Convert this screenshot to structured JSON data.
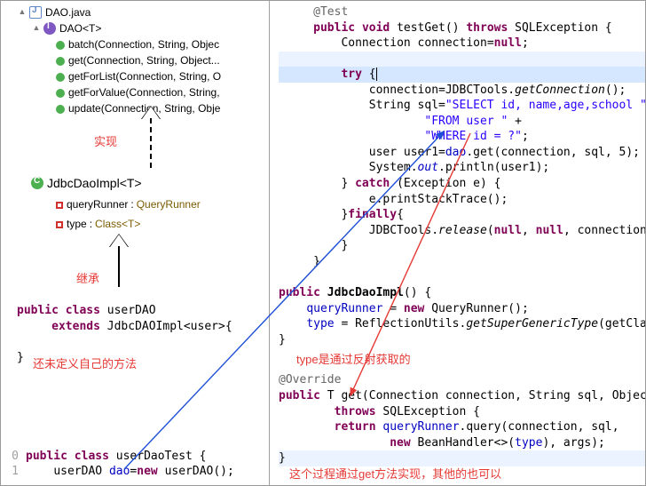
{
  "left": {
    "file": "DAO.java",
    "iface": "DAO<T>",
    "methods": [
      "batch(Connection, String, Objec",
      "get(Connection, String, Object...",
      "getForList(Connection, String, O",
      "getForValue(Connection, String,",
      "update(Connection, String, Obje"
    ],
    "anno_impl": "实现",
    "class_impl": "JdbcDaoImpl<T>",
    "fields": [
      {
        "name": "queryRunner",
        "type": "QueryRunner"
      },
      {
        "name": "type",
        "type": "Class<T>"
      }
    ],
    "anno_inherit": "继承",
    "userdao_code": {
      "l1a": "public",
      "l1b": "class",
      "l1c": "userDAO",
      "l2a": "extends",
      "l2b": "JdbcDAOImpl<user>{",
      "l3": "}"
    },
    "anno_undef": "还未定义自己的方法",
    "test_code": {
      "n0": "0",
      "n1": "1",
      "l1a": "public",
      "l1b": "class",
      "l1c": "userDaoTest {",
      "l2a": "userDAO",
      "l2b": "dao",
      "l2c": "=",
      "l2d": "new",
      "l2e": "userDAO();"
    }
  },
  "right": {
    "code": {
      "a1": "@Test",
      "a2_pub": "public",
      "a2_void": "void",
      "a2_name": "testGet()",
      "a2_throws": "throws",
      "a2_ex": "SQLException {",
      "a3": "Connection connection=",
      "a3_null": "null",
      "a3_semi": ";",
      "a4_try": "try",
      "a4_br": "{",
      "a5a": "connection=JDBCTools.",
      "a5b": "getConnection",
      "a5c": "();",
      "a6a": "String sql=",
      "a6b": "\"SELECT id, name,age,school \"",
      "a6c": " +",
      "a7a": "\"FROM user \"",
      "a7b": " +",
      "a8a": "\"WHERE id = ?\"",
      "a8b": ";",
      "a9a": "user user1=",
      "a9b": "dao",
      "a9c": ".get(connection, sql, 5);",
      "a10a": "System.",
      "a10b": "out",
      "a10c": ".println(user1);",
      "a11a": "}",
      "a11b": "catch",
      "a11c": " (Exception e) {",
      "a12": "e.printStackTrace();",
      "a13a": "}",
      "a13b": "finally",
      "a13c": "{",
      "a14a": "JDBCTools.",
      "a14b": "release",
      "a14c": "(",
      "a14d": "null",
      "a14e": ", ",
      "a14f": "null",
      "a14g": ", connection);",
      "a15": "}",
      "a16": "}",
      "b1_pub": "public",
      "b1_name": "JdbcDaoImpl",
      "b1_br": "() {",
      "b2a": "queryRunner",
      "b2b": " = ",
      "b2c": "new",
      "b2d": " QueryRunner();",
      "b3a": "type",
      "b3b": " = ReflectionUtils.",
      "b3c": "getSuperGenericType",
      "b3d": "(getClass());",
      "b4": "}",
      "anno_type": "type是通过反射获取的",
      "c1": "@Override",
      "c2_pub": "public",
      "c2_t": " T get(Connection connection, String sql, Object... args)",
      "c3_throws": "throws",
      "c3_ex": " SQLException {",
      "c4_ret": "return",
      "c4a": " ",
      "c4b": "queryRunner",
      "c4c": ".query(connection, sql,",
      "c5_new": "new",
      "c5a": " BeanHandler<>(",
      "c5b": "type",
      "c5c": "), args);",
      "c6": "}",
      "anno_get": "这个过程通过get方法实现，其他的也可以"
    }
  },
  "chart_data": {
    "type": "diagram",
    "nodes": [
      "DAO<T>",
      "JdbcDaoImpl<T>",
      "userDAO",
      "userDaoTest"
    ],
    "edges": [
      {
        "from": "JdbcDaoImpl<T>",
        "to": "DAO<T>",
        "kind": "implements",
        "label": "实现"
      },
      {
        "from": "userDAO",
        "to": "JdbcDaoImpl<T>",
        "kind": "extends",
        "label": "继承"
      },
      {
        "from": "userDaoTest.dao",
        "to": "dao.get(...)",
        "kind": "reference",
        "color": "blue"
      },
      {
        "from": "dao.get call",
        "to": "T get(...)",
        "kind": "reference",
        "color": "red"
      }
    ]
  }
}
